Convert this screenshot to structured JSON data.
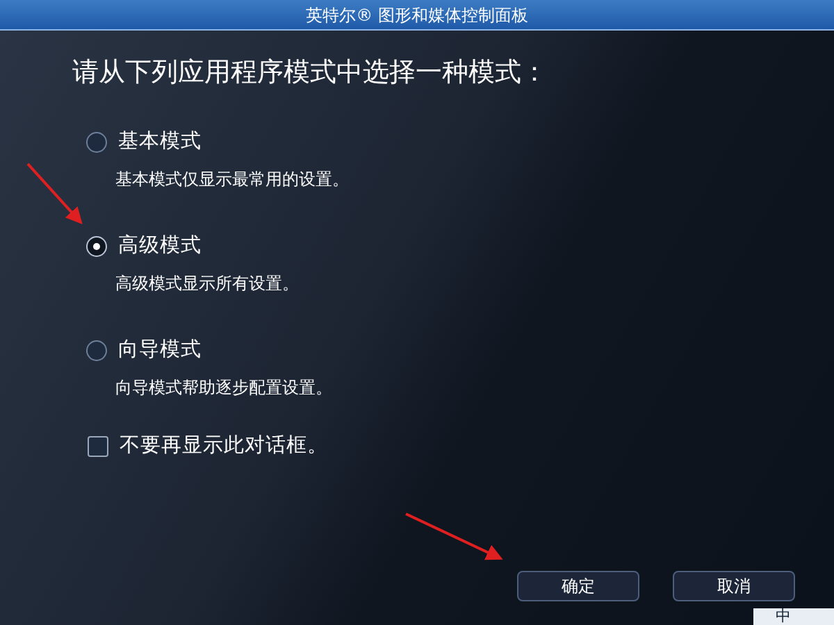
{
  "window": {
    "title": "英特尔® 图形和媒体控制面板"
  },
  "heading": "请从下列应用程序模式中选择一种模式：",
  "modes": [
    {
      "label": "基本模式",
      "description": "基本模式仅显示最常用的设置。",
      "selected": false
    },
    {
      "label": "高级模式",
      "description": "高级模式显示所有设置。",
      "selected": true
    },
    {
      "label": "向导模式",
      "description": "向导模式帮助逐步配置设置。",
      "selected": false
    }
  ],
  "dont_show_again": {
    "label": "不要再显示此对话框。",
    "checked": false
  },
  "buttons": [
    "确定",
    "取消"
  ],
  "ime_bar": {
    "label": "中"
  }
}
